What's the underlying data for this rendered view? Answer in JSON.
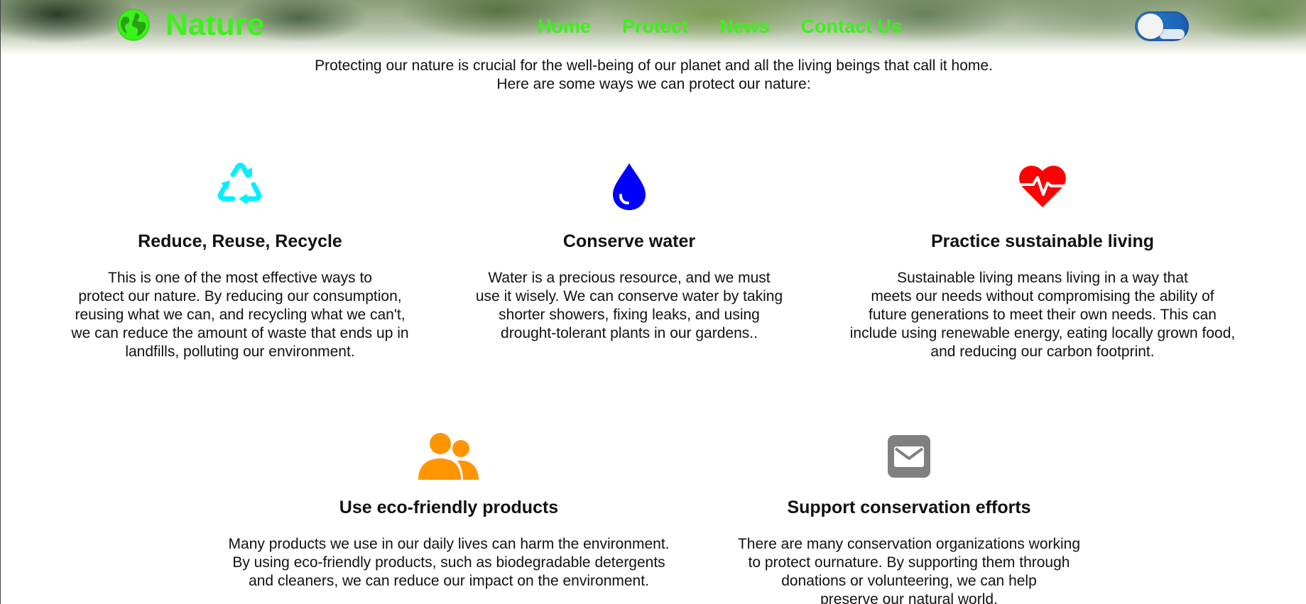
{
  "header": {
    "brand_name": "Nature",
    "brand_icon": "globe-icon",
    "accent_color": "#3bf21a",
    "nav": [
      {
        "label": "Home"
      },
      {
        "label": "Protect"
      },
      {
        "label": "News"
      },
      {
        "label": "Contact Us"
      }
    ],
    "theme_toggle": {
      "icon": "theme-toggle"
    }
  },
  "intro": {
    "line1": "Protecting our nature is crucial for the well-being of our planet and all the living beings that call it home.",
    "line2": "Here are some ways we can protect our nature:"
  },
  "cards": [
    {
      "icon": "recycle-icon",
      "icon_color": "#00f0ff",
      "title": "Reduce, Reuse, Recycle",
      "text": "This is one of the most effective ways to\nprotect our nature. By reducing our consumption,\nreusing what we can, and recycling what we can't,\nwe can reduce the amount of waste that ends up in\nlandfills, polluting our environment."
    },
    {
      "icon": "water-drop-icon",
      "icon_color": "#0000ff",
      "title": "Conserve water",
      "text": "Water is a precious resource, and we must\nuse it wisely. We can conserve water by taking\nshorter showers, fixing leaks, and using\ndrought-tolerant plants in our gardens.."
    },
    {
      "icon": "heart-pulse-icon",
      "icon_color": "#ff0000",
      "title": "Practice sustainable living",
      "text": "Sustainable living means living in a way that\nmeets our needs without compromising the ability of\nfuture generations to meet their own needs. This can\ninclude using renewable energy, eating locally grown food,\nand reducing our carbon footprint."
    },
    {
      "icon": "users-icon",
      "icon_color": "#ff9500",
      "title": "Use eco-friendly products",
      "text": "Many products we use in our daily lives can harm the environment.\nBy using eco-friendly products, such as biodegradable detergents\nand cleaners, we can reduce our impact on the environment."
    },
    {
      "icon": "envelope-icon",
      "icon_color": "#808080",
      "title": "Support conservation efforts",
      "text": "There are many conservation organizations working\nto protect ournature. By supporting them through\ndonations or volunteering, we can help\npreserve our natural world."
    }
  ]
}
